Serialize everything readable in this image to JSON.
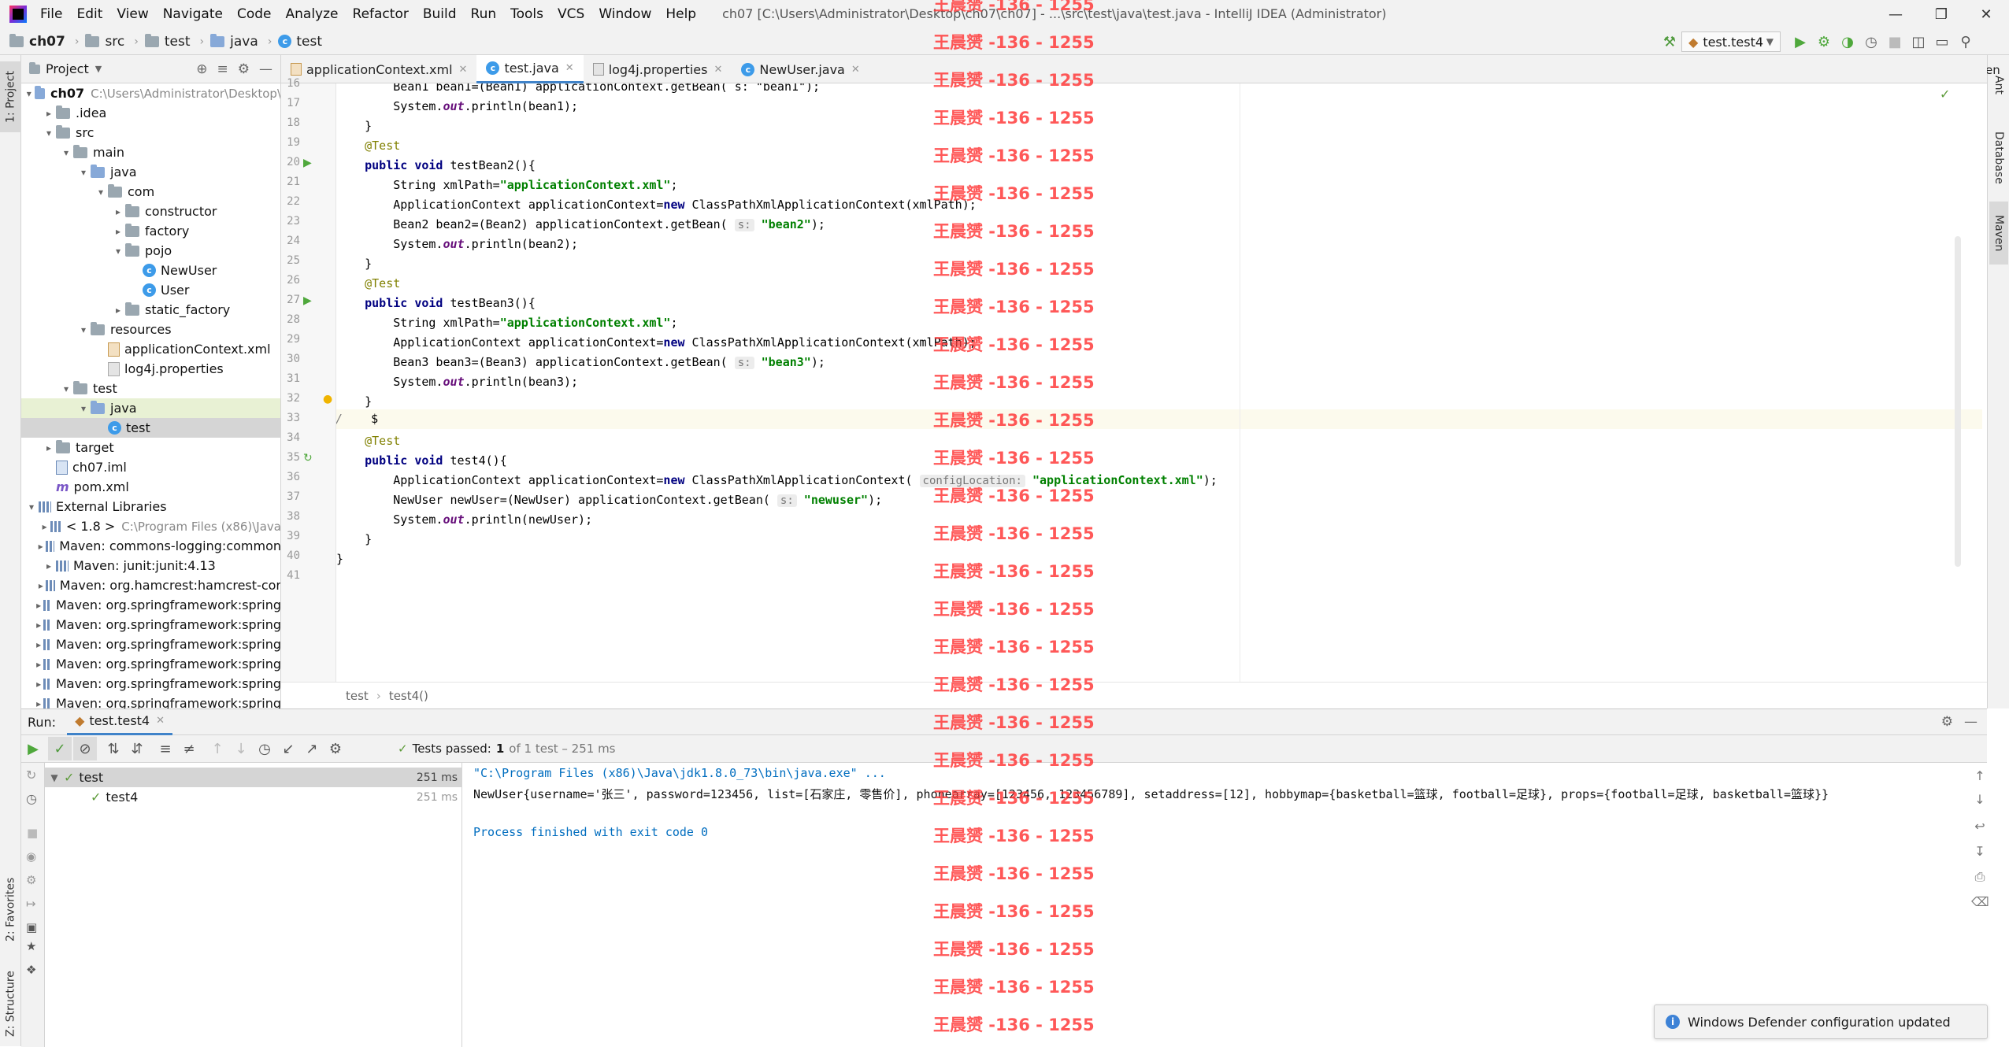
{
  "menubar": {
    "items": [
      "File",
      "Edit",
      "View",
      "Navigate",
      "Code",
      "Analyze",
      "Refactor",
      "Build",
      "Run",
      "Tools",
      "VCS",
      "Window",
      "Help"
    ],
    "window_title": "ch07 [C:\\Users\\Administrator\\Desktop\\ch07\\ch07] - ...\\src\\test\\java\\test.java - IntelliJ IDEA (Administrator)"
  },
  "navbar": {
    "crumbs": [
      "ch07",
      "src",
      "test",
      "java",
      "test"
    ],
    "run_config": "test.test4"
  },
  "left_strip": {
    "project": "1: Project",
    "favorites": "2: Favorites",
    "structure": "Z: Structure"
  },
  "right_strip": {
    "maven_top": "Maven",
    "ant": "Ant",
    "database": "Database",
    "maven": "Maven"
  },
  "project": {
    "header": "Project",
    "tree": [
      {
        "label": "ch07",
        "path": "C:\\Users\\Administrator\\Desktop\\"
      },
      {
        "label": ".idea"
      },
      {
        "label": "src"
      },
      {
        "label": "main"
      },
      {
        "label": "java"
      },
      {
        "label": "com"
      },
      {
        "label": "constructor"
      },
      {
        "label": "factory"
      },
      {
        "label": "pojo"
      },
      {
        "label": "NewUser"
      },
      {
        "label": "User"
      },
      {
        "label": "static_factory"
      },
      {
        "label": "resources"
      },
      {
        "label": "applicationContext.xml"
      },
      {
        "label": "log4j.properties"
      },
      {
        "label": "test"
      },
      {
        "label": "java"
      },
      {
        "label": "test"
      },
      {
        "label": "target"
      },
      {
        "label": "ch07.iml"
      },
      {
        "label": "pom.xml"
      },
      {
        "label": "External Libraries"
      },
      {
        "label": "< 1.8 >",
        "path": "C:\\Program Files (x86)\\Java"
      },
      {
        "label": "Maven: commons-logging:common"
      },
      {
        "label": "Maven: junit:junit:4.13"
      },
      {
        "label": "Maven: org.hamcrest:hamcrest-cor"
      },
      {
        "label": "Maven: org.springframework:spring"
      },
      {
        "label": "Maven: org.springframework:spring"
      },
      {
        "label": "Maven: org.springframework:spring"
      },
      {
        "label": "Maven: org.springframework:spring"
      },
      {
        "label": "Maven: org.springframework:spring"
      },
      {
        "label": "Maven: org.springframework:spring"
      }
    ]
  },
  "editor": {
    "tabs": [
      "applicationContext.xml",
      "test.java",
      "log4j.properties",
      "NewUser.java"
    ],
    "line_numbers": [
      "16",
      "17",
      "18",
      "19",
      "20",
      "21",
      "22",
      "23",
      "24",
      "25",
      "26",
      "27",
      "28",
      "29",
      "30",
      "31",
      "32",
      "33",
      "34",
      "35",
      "36",
      "37",
      "38",
      "39",
      "40",
      "41"
    ],
    "code": {
      "l16": "        Bean1 bean1=(Bean1) applicationContext.getBean( s: \"bean1\");",
      "l17a": "        System.",
      "l17b": "out",
      "l17c": ".println(bean1);",
      "l18": "    }",
      "l19": "    @Test",
      "l20a": "    public void ",
      "l20b": "testBean2(){",
      "l21a": "        String xmlPath=",
      "l21b": "\"applicationContext.xml\"",
      "l21c": ";",
      "l22a": "        ApplicationContext applicationContext=",
      "l22b": "new ",
      "l22c": "ClassPathXmlApplicationContext(xmlPath);",
      "l23a": "        Bean2 bean2=(Bean2) applicationContext.getBean( ",
      "l23h": "s:",
      "l23b": " \"bean2\"",
      "l23c": ");",
      "l24a": "        System.",
      "l24b": "out",
      "l24c": ".println(bean2);",
      "l25": "    }",
      "l26": "    @Test",
      "l27a": "    public void ",
      "l27b": "testBean3(){",
      "l28a": "        String xmlPath=",
      "l28b": "\"applicationContext.xml\"",
      "l28c": ";",
      "l29a": "        ApplicationContext applicationContext=",
      "l29b": "new ",
      "l29c": "ClassPathXmlApplicationContext(xmlPath);",
      "l30a": "        Bean3 bean3=(Bean3) applicationContext.getBean( ",
      "l30h": "s:",
      "l30b": " \"bean3\"",
      "l30c": ");",
      "l31a": "        System.",
      "l31b": "out",
      "l31c": ".println(bean3);",
      "l32": "    }",
      "l33a": "//",
      "l33b": "    $",
      "l34": "    @Test",
      "l35a": "    public void ",
      "l35b": "test4(){",
      "l36a": "        ApplicationContext applicationContext=",
      "l36b": "new ",
      "l36c": "ClassPathXmlApplicationContext( ",
      "l36h": "configLocation:",
      "l36d": " \"applicationContext.xml\"",
      "l36e": ");",
      "l37a": "        NewUser newUser=(NewUser) applicationContext.getBean( ",
      "l37h": "s:",
      "l37b": " \"newuser\"",
      "l37c": ");",
      "l38a": "        System.",
      "l38b": "out",
      "l38c": ".println(newUser);",
      "l39": "    }",
      "l40": "}"
    },
    "breadcrumb": [
      "test",
      "test4()"
    ]
  },
  "run": {
    "label": "Run:",
    "tab": "test.test4",
    "status_prefix": "Tests passed:",
    "status_count": "1",
    "status_suffix": "of 1 test – 251 ms",
    "tree": [
      {
        "name": "test",
        "time": "251 ms"
      },
      {
        "name": "test4",
        "time": "251 ms"
      }
    ],
    "console": [
      "\"C:\\Program Files (x86)\\Java\\jdk1.8.0_73\\bin\\java.exe\" ...",
      "NewUser{username='张三', password=123456, list=[石家庄, 零售价], phonearray=[123456, 123456789], setaddress=[12], hobbymap={basketball=篮球, football=足球}, props={football=足球, basketball=篮球}}",
      "Process finished with exit code 0"
    ]
  },
  "watermark": "王晨赟 -136 - 1255",
  "notification": "Windows Defender configuration updated",
  "colors": {
    "accent": "#4083c9",
    "success": "#5d9b3a",
    "keyword": "#000080",
    "string": "#008000",
    "watermark": "#ff3b3b"
  }
}
